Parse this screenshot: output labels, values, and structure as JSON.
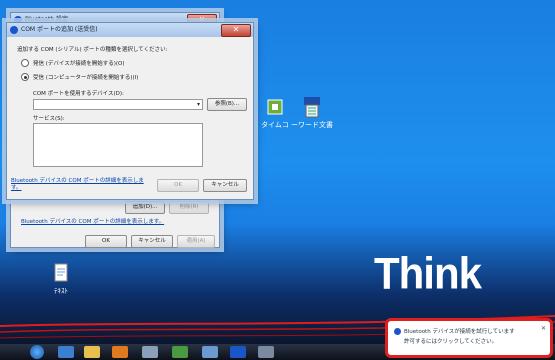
{
  "desktop": {
    "brand_text": "Think",
    "icons": [
      {
        "label": "タイムコ",
        "icon": "app-shortcut-icon"
      },
      {
        "label": "ーワード文書",
        "icon": "excel-shortcut-icon"
      },
      {
        "label": "ﾃｷｽﾄ",
        "icon": "text-file-icon"
      }
    ]
  },
  "bt_settings": {
    "title": "Bluetooth 設定",
    "link": "Bluetooth デバイスの COM ポートの詳細を表示します。",
    "buttons": {
      "add": "追加(D)...",
      "remove": "削除(R)",
      "ok": "OK",
      "cancel": "キャンセル",
      "apply": "適用(A)"
    }
  },
  "com_dialog": {
    "title": "COM ポートの追加 (送受信)",
    "instruction": "追加する COM (シリアル) ポートの種類を選択してください:",
    "radio_outgoing": "発信 (デバイスが接続を開始する)(O)",
    "radio_incoming": "受信 (コンピューターが接続を開始する)(I)",
    "device_label": "COM ポートを使用するデバイス(D):",
    "browse_button": "参照(B)...",
    "service_label": "サービス(S):",
    "link": "Bluetooth デバイスの COM ポートの詳細を表示します。",
    "ok": "OK",
    "cancel": "キャンセル"
  },
  "notification": {
    "line1": "Bluetooth デバイスが接続を試行しています",
    "line2": "許可するにはクリックしてください。"
  },
  "colors": {
    "accent_red": "#e02020",
    "desktop_blue": "#1e8fee"
  }
}
